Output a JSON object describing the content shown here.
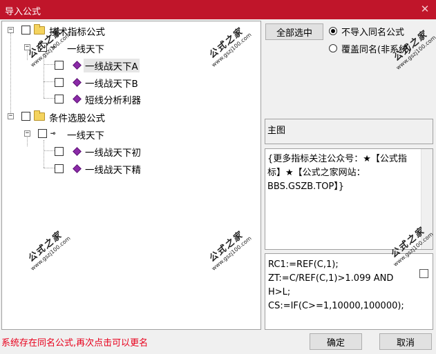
{
  "window": {
    "title": "导入公式",
    "close_glyph": "✕",
    "titlebar_color": "#c0152a"
  },
  "tree": {
    "nodes": [
      {
        "label": "技术指标公式",
        "icon": "folder-icon"
      },
      {
        "label": "一线天下",
        "icon": "key-icon"
      },
      {
        "label": "一线战天下A",
        "icon": "formula-icon",
        "selected": true
      },
      {
        "label": "一线战天下B",
        "icon": "formula-icon"
      },
      {
        "label": "短线分析利器",
        "icon": "formula-icon"
      },
      {
        "label": "条件选股公式",
        "icon": "folder-icon"
      },
      {
        "label": "一线天下",
        "icon": "key-icon"
      },
      {
        "label": "一线战天下初",
        "icon": "formula-icon"
      },
      {
        "label": "一线战天下精",
        "icon": "formula-icon"
      }
    ],
    "expander_glyph": "−",
    "key_glyph": "⊸"
  },
  "watermark": {
    "line1": "公式之家",
    "line2": "www.gszj100.com"
  },
  "controls": {
    "select_all_label": "全部选中",
    "radio_skip_label": "不导入同名公式",
    "radio_overwrite_label": "覆盖同名(非系统)",
    "radio_selected": "skip"
  },
  "panels": {
    "chart_type_label": "主图",
    "description_text": "{更多指标关注公众号：★【公式指标】★【公式之家网站：BBS.GSZB.TOP】}",
    "code_text": "RC1:=REF(C,1);\nZT:=C/REF(C,1)>1.099 AND H>L;\nCS:=IF(C>=1,10000,100000);"
  },
  "footer": {
    "status_text": "系统存在同名公式,再次点击可以更名",
    "status_color": "#e8001c",
    "ok_label": "确定",
    "cancel_label": "取消"
  }
}
